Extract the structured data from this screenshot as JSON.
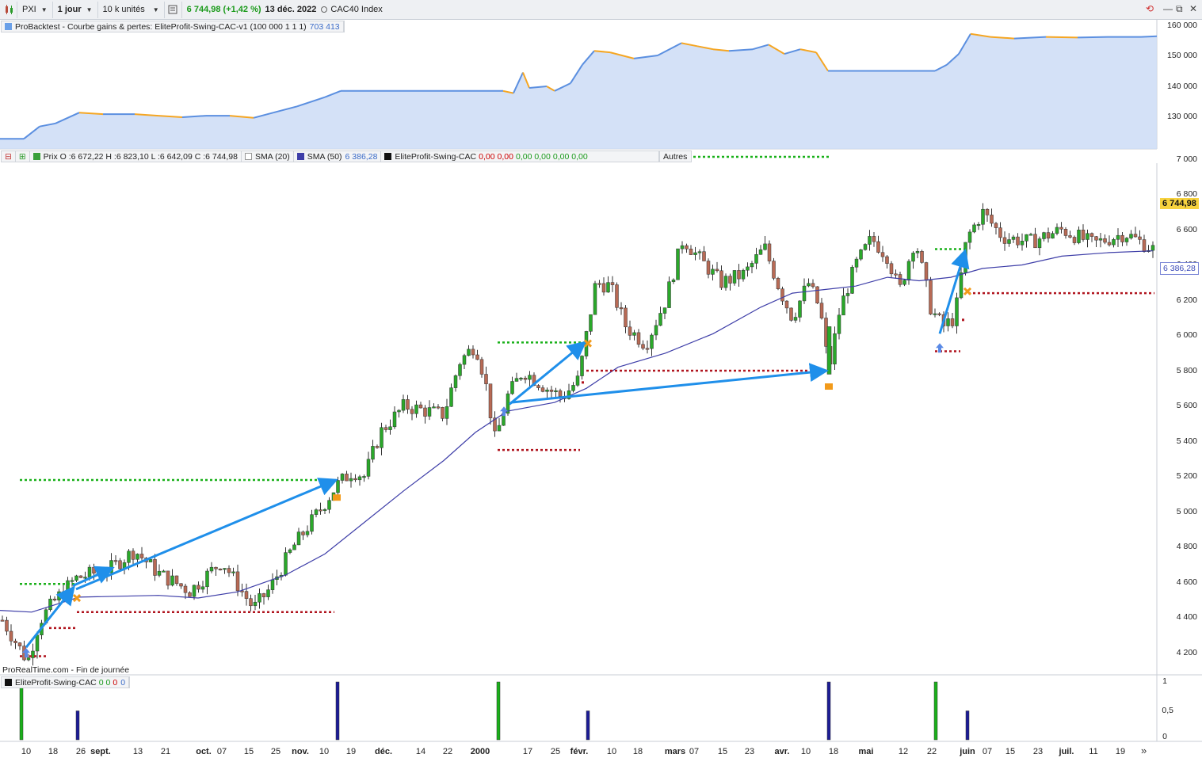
{
  "toolbar": {
    "symbol": "PXI",
    "period": "1 jour",
    "units": "10 k unités",
    "price_change": "6 744,98 (+1,42 %)",
    "date": "13 déc. 2022",
    "index_label": "CAC40 Index"
  },
  "equity_panel": {
    "legend_title": "ProBacktest - Courbe gains & pertes: EliteProfit-Swing-CAC-v1 (100 000 1 1 1)",
    "legend_value": "703 413",
    "y_ticks": [
      "160 000",
      "150 000",
      "140 000",
      "130 000"
    ],
    "colors": {
      "fill": "#cddcf6",
      "line_up": "#5b8fe0",
      "line_down": "#f5a623"
    }
  },
  "price_panel": {
    "legend": {
      "price": "Prix O :6 672,22 H :6 823,10 L :6 642,09 C :6 744,98",
      "sma20": "SMA (20)",
      "sma50": "SMA (50)",
      "sma50_value": "6 386,28",
      "indicator": "EliteProfit-Swing-CAC",
      "indicator_values": [
        "0,00",
        "0,00",
        "0,00",
        "0,00",
        "0,00",
        "0,00"
      ],
      "others": "Autres"
    },
    "y_ticks": [
      "7 000",
      "6 800",
      "6 600",
      "6 400",
      "6 200",
      "6 000",
      "5 800",
      "5 600",
      "5 400",
      "5 200",
      "5 000",
      "4 800",
      "4 600",
      "4 400",
      "4 200"
    ],
    "last_price_tag": "6 744,98",
    "sma_tag": "6 386,28",
    "footer": "ProRealTime.com - Fin de journée",
    "colors": {
      "up": "#2aa82a",
      "down": "#b86a55",
      "sma": "#3e3ea8",
      "arrow": "#1f8fea",
      "target": "#19b019",
      "stop": "#b0141e"
    }
  },
  "indicator_panel": {
    "legend": "EliteProfit-Swing-CAC",
    "legend_values": [
      "0",
      "0",
      "0",
      "0"
    ],
    "y_ticks": [
      "1",
      "0,5",
      "0"
    ]
  },
  "x_axis": {
    "labels": [
      "10",
      "18",
      "26",
      "sept.",
      "13",
      "21",
      "oct.",
      "07",
      "15",
      "25",
      "nov.",
      "10",
      "19",
      "déc.",
      "14",
      "22",
      "2000",
      "17",
      "25",
      "févr.",
      "10",
      "18",
      "mars",
      "07",
      "15",
      "23",
      "avr.",
      "10",
      "18",
      "mai",
      "12",
      "22",
      "juin",
      "07",
      "15",
      "23",
      "juil.",
      "11",
      "19"
    ],
    "bold": [
      "sept.",
      "oct.",
      "nov.",
      "déc.",
      "2000",
      "févr.",
      "mars",
      "avr.",
      "mai",
      "juin",
      "juil."
    ]
  }
}
